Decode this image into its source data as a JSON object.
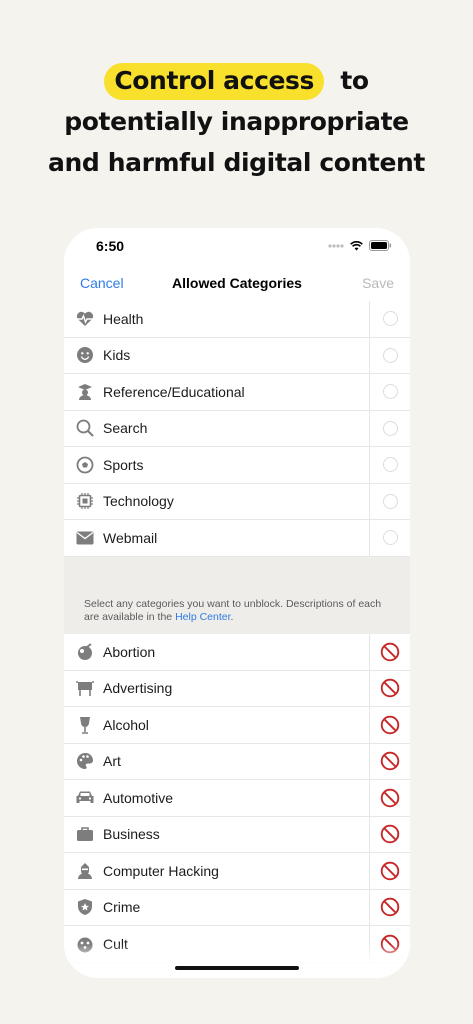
{
  "headline": {
    "highlight": "Control access",
    "line1_rest": "to",
    "line2": "potentially inappropriate",
    "line3": "and harmful digital content"
  },
  "status_bar": {
    "time": "6:50"
  },
  "nav": {
    "cancel": "Cancel",
    "title": "Allowed Categories",
    "save": "Save"
  },
  "allowed_items": [
    {
      "label": "Health",
      "icon": "heart-pulse-icon"
    },
    {
      "label": "Kids",
      "icon": "smiley-face-icon"
    },
    {
      "label": "Reference/Educational",
      "icon": "graduate-icon"
    },
    {
      "label": "Search",
      "icon": "magnifier-icon"
    },
    {
      "label": "Sports",
      "icon": "ball-icon"
    },
    {
      "label": "Technology",
      "icon": "chip-icon"
    },
    {
      "label": "Webmail",
      "icon": "envelope-icon"
    }
  ],
  "info": {
    "text": "Select any categories you want to unblock. Descriptions of each are available in the ",
    "link": "Help Center",
    "end": "."
  },
  "blocked_items": [
    {
      "label": "Abortion",
      "icon": "abortion-icon"
    },
    {
      "label": "Advertising",
      "icon": "billboard-icon"
    },
    {
      "label": "Alcohol",
      "icon": "wine-glass-icon"
    },
    {
      "label": "Art",
      "icon": "palette-icon"
    },
    {
      "label": "Automotive",
      "icon": "car-icon"
    },
    {
      "label": "Business",
      "icon": "briefcase-icon"
    },
    {
      "label": "Computer Hacking",
      "icon": "hacker-icon"
    },
    {
      "label": "Crime",
      "icon": "badge-icon"
    },
    {
      "label": "Cult",
      "icon": "cult-icon"
    }
  ],
  "colors": {
    "accent": "#2f7be6",
    "highlight": "#f8e02c",
    "blocked": "#c62828",
    "icon": "#7d7d7d"
  }
}
